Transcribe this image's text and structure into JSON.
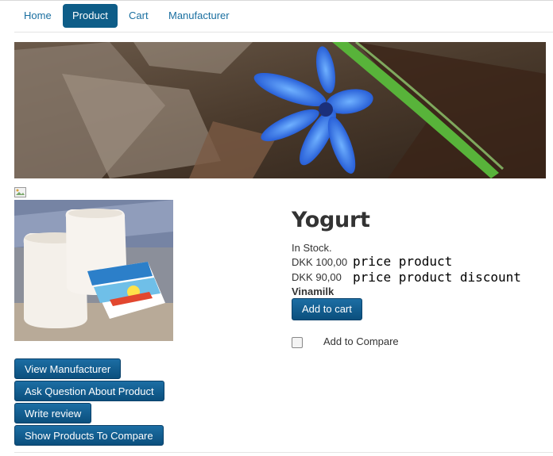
{
  "nav": {
    "items": [
      {
        "label": "Home",
        "active": false
      },
      {
        "label": "Product",
        "active": true
      },
      {
        "label": "Cart",
        "active": false
      },
      {
        "label": "Manufacturer",
        "active": false
      }
    ]
  },
  "product": {
    "title": "Yogurt",
    "stock": "In Stock.",
    "price": "DKK 100,00",
    "price_note": "price product",
    "discount_price": "DKK 90,00",
    "discount_note": "price product discount",
    "manufacturer": "Vinamilk",
    "add_to_cart": "Add to cart",
    "add_to_compare": "Add to Compare"
  },
  "actions": {
    "view_manufacturer": "View Manufacturer",
    "ask_question": "Ask Question About Product",
    "write_review": "Write review",
    "show_compare": "Show Products To Compare"
  },
  "colors": {
    "accent": "#0e5d88",
    "link": "#1a6fa0"
  }
}
